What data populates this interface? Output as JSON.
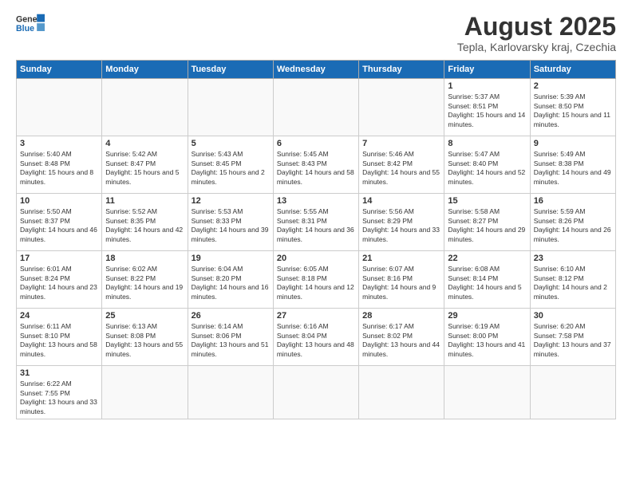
{
  "header": {
    "logo_general": "General",
    "logo_blue": "Blue",
    "month_title": "August 2025",
    "subtitle": "Tepla, Karlovarsky kraj, Czechia"
  },
  "weekdays": [
    "Sunday",
    "Monday",
    "Tuesday",
    "Wednesday",
    "Thursday",
    "Friday",
    "Saturday"
  ],
  "weeks": [
    [
      {
        "day": "",
        "info": "",
        "empty": true
      },
      {
        "day": "",
        "info": "",
        "empty": true
      },
      {
        "day": "",
        "info": "",
        "empty": true
      },
      {
        "day": "",
        "info": "",
        "empty": true
      },
      {
        "day": "",
        "info": "",
        "empty": true
      },
      {
        "day": "1",
        "info": "Sunrise: 5:37 AM\nSunset: 8:51 PM\nDaylight: 15 hours and 14 minutes."
      },
      {
        "day": "2",
        "info": "Sunrise: 5:39 AM\nSunset: 8:50 PM\nDaylight: 15 hours and 11 minutes."
      }
    ],
    [
      {
        "day": "3",
        "info": "Sunrise: 5:40 AM\nSunset: 8:48 PM\nDaylight: 15 hours and 8 minutes."
      },
      {
        "day": "4",
        "info": "Sunrise: 5:42 AM\nSunset: 8:47 PM\nDaylight: 15 hours and 5 minutes."
      },
      {
        "day": "5",
        "info": "Sunrise: 5:43 AM\nSunset: 8:45 PM\nDaylight: 15 hours and 2 minutes."
      },
      {
        "day": "6",
        "info": "Sunrise: 5:45 AM\nSunset: 8:43 PM\nDaylight: 14 hours and 58 minutes."
      },
      {
        "day": "7",
        "info": "Sunrise: 5:46 AM\nSunset: 8:42 PM\nDaylight: 14 hours and 55 minutes."
      },
      {
        "day": "8",
        "info": "Sunrise: 5:47 AM\nSunset: 8:40 PM\nDaylight: 14 hours and 52 minutes."
      },
      {
        "day": "9",
        "info": "Sunrise: 5:49 AM\nSunset: 8:38 PM\nDaylight: 14 hours and 49 minutes."
      }
    ],
    [
      {
        "day": "10",
        "info": "Sunrise: 5:50 AM\nSunset: 8:37 PM\nDaylight: 14 hours and 46 minutes."
      },
      {
        "day": "11",
        "info": "Sunrise: 5:52 AM\nSunset: 8:35 PM\nDaylight: 14 hours and 42 minutes."
      },
      {
        "day": "12",
        "info": "Sunrise: 5:53 AM\nSunset: 8:33 PM\nDaylight: 14 hours and 39 minutes."
      },
      {
        "day": "13",
        "info": "Sunrise: 5:55 AM\nSunset: 8:31 PM\nDaylight: 14 hours and 36 minutes."
      },
      {
        "day": "14",
        "info": "Sunrise: 5:56 AM\nSunset: 8:29 PM\nDaylight: 14 hours and 33 minutes."
      },
      {
        "day": "15",
        "info": "Sunrise: 5:58 AM\nSunset: 8:27 PM\nDaylight: 14 hours and 29 minutes."
      },
      {
        "day": "16",
        "info": "Sunrise: 5:59 AM\nSunset: 8:26 PM\nDaylight: 14 hours and 26 minutes."
      }
    ],
    [
      {
        "day": "17",
        "info": "Sunrise: 6:01 AM\nSunset: 8:24 PM\nDaylight: 14 hours and 23 minutes."
      },
      {
        "day": "18",
        "info": "Sunrise: 6:02 AM\nSunset: 8:22 PM\nDaylight: 14 hours and 19 minutes."
      },
      {
        "day": "19",
        "info": "Sunrise: 6:04 AM\nSunset: 8:20 PM\nDaylight: 14 hours and 16 minutes."
      },
      {
        "day": "20",
        "info": "Sunrise: 6:05 AM\nSunset: 8:18 PM\nDaylight: 14 hours and 12 minutes."
      },
      {
        "day": "21",
        "info": "Sunrise: 6:07 AM\nSunset: 8:16 PM\nDaylight: 14 hours and 9 minutes."
      },
      {
        "day": "22",
        "info": "Sunrise: 6:08 AM\nSunset: 8:14 PM\nDaylight: 14 hours and 5 minutes."
      },
      {
        "day": "23",
        "info": "Sunrise: 6:10 AM\nSunset: 8:12 PM\nDaylight: 14 hours and 2 minutes."
      }
    ],
    [
      {
        "day": "24",
        "info": "Sunrise: 6:11 AM\nSunset: 8:10 PM\nDaylight: 13 hours and 58 minutes."
      },
      {
        "day": "25",
        "info": "Sunrise: 6:13 AM\nSunset: 8:08 PM\nDaylight: 13 hours and 55 minutes."
      },
      {
        "day": "26",
        "info": "Sunrise: 6:14 AM\nSunset: 8:06 PM\nDaylight: 13 hours and 51 minutes."
      },
      {
        "day": "27",
        "info": "Sunrise: 6:16 AM\nSunset: 8:04 PM\nDaylight: 13 hours and 48 minutes."
      },
      {
        "day": "28",
        "info": "Sunrise: 6:17 AM\nSunset: 8:02 PM\nDaylight: 13 hours and 44 minutes."
      },
      {
        "day": "29",
        "info": "Sunrise: 6:19 AM\nSunset: 8:00 PM\nDaylight: 13 hours and 41 minutes."
      },
      {
        "day": "30",
        "info": "Sunrise: 6:20 AM\nSunset: 7:58 PM\nDaylight: 13 hours and 37 minutes."
      }
    ],
    [
      {
        "day": "31",
        "info": "Sunrise: 6:22 AM\nSunset: 7:55 PM\nDaylight: 13 hours and 33 minutes."
      },
      {
        "day": "",
        "info": "",
        "empty": true
      },
      {
        "day": "",
        "info": "",
        "empty": true
      },
      {
        "day": "",
        "info": "",
        "empty": true
      },
      {
        "day": "",
        "info": "",
        "empty": true
      },
      {
        "day": "",
        "info": "",
        "empty": true
      },
      {
        "day": "",
        "info": "",
        "empty": true
      }
    ]
  ]
}
